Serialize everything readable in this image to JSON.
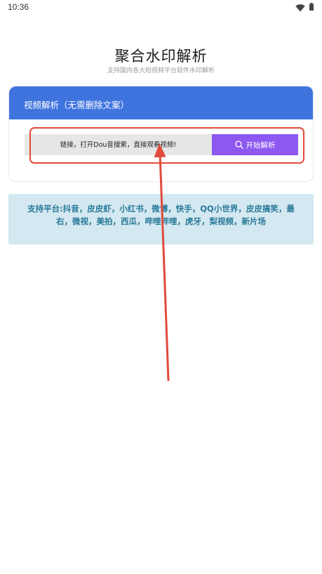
{
  "status_bar": {
    "time": "10:36",
    "wifi_icon": "wifi-icon",
    "battery_icon": "battery-icon"
  },
  "header": {
    "title": "聚合水印解析",
    "subtitle": "支持国内各大短视频平台软件水印解析"
  },
  "parse_card": {
    "title": "视频解析（无需删除文案）",
    "input_placeholder": "链接，打开Dou音搜索，直接观看视频!",
    "button_label": "开始解析",
    "button_icon": "search-icon"
  },
  "platforms": {
    "text": "支持平台:抖音，皮皮虾，小红书，微博，快手，QQ小世界，皮皮搞笑，最右，微视，美拍，西瓜，哔哩哔哩，虎牙，梨视频，新片场"
  },
  "colors": {
    "header_blue": "#3f74df",
    "button_purple": "#8c58f0",
    "panel_bg": "#d3e8f0",
    "panel_text": "#2a7a9a",
    "annotation_red": "#e24a3b"
  }
}
